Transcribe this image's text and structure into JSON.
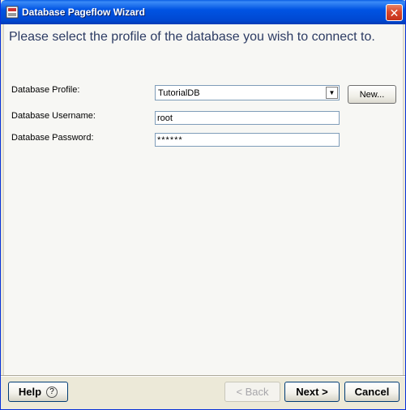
{
  "window": {
    "title": "Database Pageflow Wizard",
    "close_symbol": "✕"
  },
  "page": {
    "heading": "Please select the profile of the database you wish to connect to."
  },
  "form": {
    "profile_label": "Database Profile:",
    "profile_value": "TutorialDB",
    "new_button": "New...",
    "username_label": "Database Username:",
    "username_value": "root",
    "password_label": "Database Password:",
    "password_value": "******"
  },
  "footer": {
    "help_label": "Help",
    "help_symbol": "?",
    "back_label": "< Back",
    "next_label": "Next >",
    "cancel_label": "Cancel"
  }
}
